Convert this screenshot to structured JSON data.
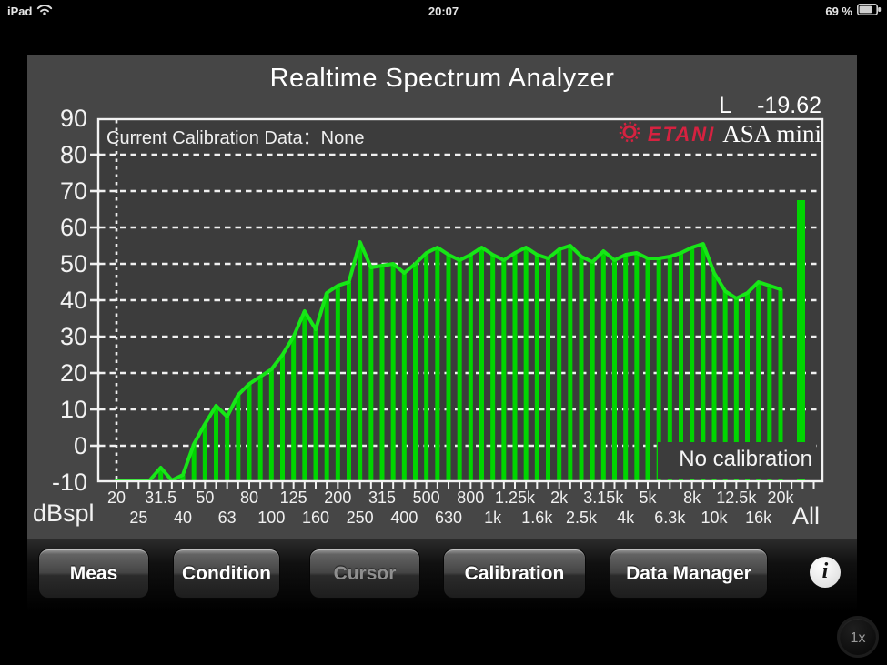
{
  "status_bar": {
    "carrier": "iPad",
    "time": "20:07",
    "battery": "69 %"
  },
  "header": {
    "title": "Realtime Spectrum Analyzer",
    "level_channel": "L",
    "level_value": "-19.62"
  },
  "plot": {
    "calibration_text": "Current Calibration Data：None",
    "logo_brand": "ETANI",
    "logo_product": "ASA mini",
    "logo_color": "#d62240",
    "no_calibration_text": "No calibration",
    "y_unit_label": "dBspl",
    "all_label": "All"
  },
  "chart_data": {
    "type": "bar",
    "title": "Realtime Spectrum Analyzer",
    "ylabel": "dBspl",
    "ylim": [
      -10,
      90
    ],
    "grid": "dashed horizontal every 10 dB, dotted vertical at 20 Hz",
    "y_ticks": [
      "90",
      "80",
      "70",
      "60",
      "50",
      "40",
      "30",
      "20",
      "10",
      "0",
      "-10"
    ],
    "band_labels_row1": [
      "20",
      "31.5",
      "50",
      "80",
      "125",
      "200",
      "315",
      "500",
      "800",
      "1.25k",
      "2k",
      "3.15k",
      "5k",
      "8k",
      "12.5k",
      "20k"
    ],
    "band_labels_row2": [
      "25",
      "40",
      "63",
      "100",
      "160",
      "250",
      "400",
      "630",
      "1k",
      "1.6k",
      "2.5k",
      "4k",
      "6.3k",
      "10k",
      "16k"
    ],
    "bands_third_octave": [
      "20",
      "25",
      "31.5",
      "40",
      "50",
      "63",
      "80",
      "100",
      "125",
      "160",
      "200",
      "250",
      "315",
      "400",
      "500",
      "630",
      "800",
      "1k",
      "1.25k",
      "1.6k",
      "2k",
      "2.5k",
      "3.15k",
      "4k",
      "5k",
      "6.3k",
      "8k",
      "10k",
      "12.5k",
      "16k",
      "20k"
    ],
    "values_sixth_octave_dB": [
      -10,
      -10,
      -10,
      -10,
      -6,
      -10,
      -8,
      0.5,
      6,
      11,
      8,
      14,
      17,
      19,
      21,
      25,
      30,
      37,
      32,
      42,
      44,
      45,
      56,
      49,
      49.5,
      50,
      47.5,
      50,
      53,
      54.5,
      52.5,
      51,
      52.5,
      54.5,
      52.5,
      51,
      53,
      54.5,
      52.5,
      51.5,
      54,
      55,
      52,
      50.5,
      53.5,
      51,
      52.5,
      53,
      51.5,
      51.5,
      52,
      53,
      54.5,
      55.5,
      47.5,
      42.5,
      40.5,
      42,
      45,
      44,
      43
    ],
    "all_bar_value_dB": 67.5,
    "bar_color": "#00d400",
    "line_color": "#17e617",
    "grid_color": "#f0f0f0"
  },
  "toolbar": {
    "buttons": [
      {
        "label": "Meas",
        "enabled": true
      },
      {
        "label": "Condition",
        "enabled": true
      },
      {
        "label": "Cursor",
        "enabled": false
      },
      {
        "label": "Calibration",
        "enabled": true
      },
      {
        "label": "Data Manager",
        "enabled": true
      }
    ],
    "info_label": "i"
  },
  "corner_button_label": "1x"
}
